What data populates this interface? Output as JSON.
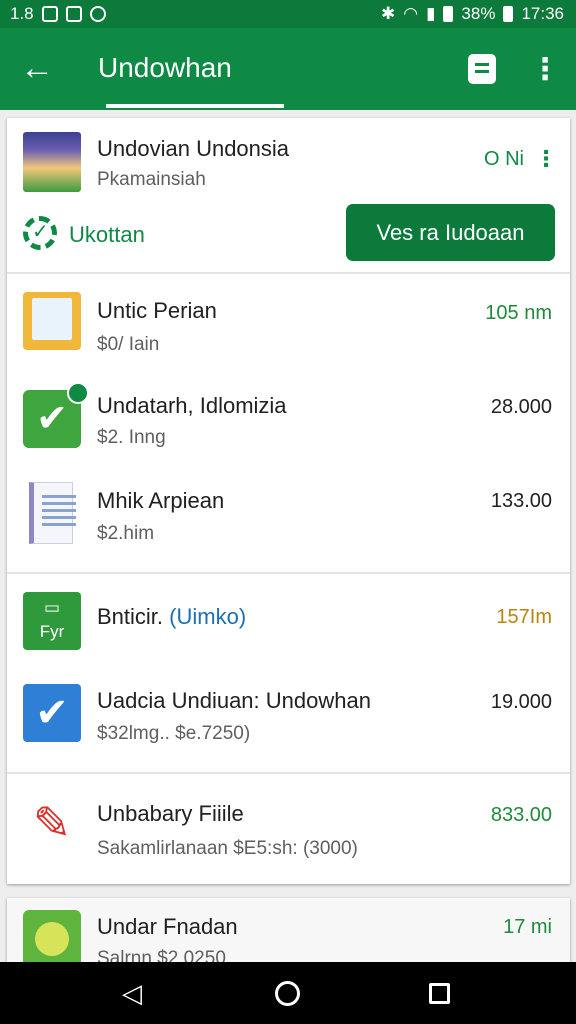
{
  "status_bar": {
    "left_text": "1.8",
    "battery": "38%",
    "time": "17:36"
  },
  "app_bar": {
    "title": "Undowhan",
    "back_icon": "arrow-left-icon",
    "action_icon": "document-icon",
    "overflow_icon": "more-vert-icon"
  },
  "header": {
    "name": "Undovian Undonsia",
    "subtitle": "Pkamainsiah",
    "amount": "O Ni",
    "status_label": "Ukottan",
    "cta_label": "Ves ra Iudoaan"
  },
  "items": [
    {
      "name": "Untic Perian",
      "sub": "$0/ Iain",
      "amount": "105 nm",
      "amount_color": "#1f8a3b"
    },
    {
      "name": "Undatarh, Idlomizia",
      "sub": "$2. Inng",
      "amount": "28.000",
      "amount_color": "#212121"
    },
    {
      "name": "Mhik Arpiean",
      "sub": "$2.him",
      "amount": "133.00",
      "amount_color": "#212121"
    },
    {
      "name": "Bnticir.",
      "name_accent": "(Uimko)",
      "sub": "",
      "amount": "157Im",
      "amount_color": "#b7860b",
      "icon_text": "Fyr"
    },
    {
      "name": "Uadcia Undiuan: Undowhan",
      "sub": "$32lmg..  $e.7250)",
      "amount": "19.000",
      "amount_color": "#212121"
    },
    {
      "name": "Unbabary Fiiile",
      "sub": "Sakamlirlanaan $E5:sh: (3000)",
      "amount": "833.00",
      "amount_color": "#1f8a3b"
    }
  ],
  "partial_item": {
    "name": "Undar Fnadan",
    "sub": "Salrnn  $2 0250",
    "amount": "17 mi",
    "amount_color": "#1f8a3b"
  },
  "nav": {
    "back_icon": "nav-back-icon",
    "home_icon": "nav-home-icon",
    "recent_icon": "nav-recents-icon"
  }
}
